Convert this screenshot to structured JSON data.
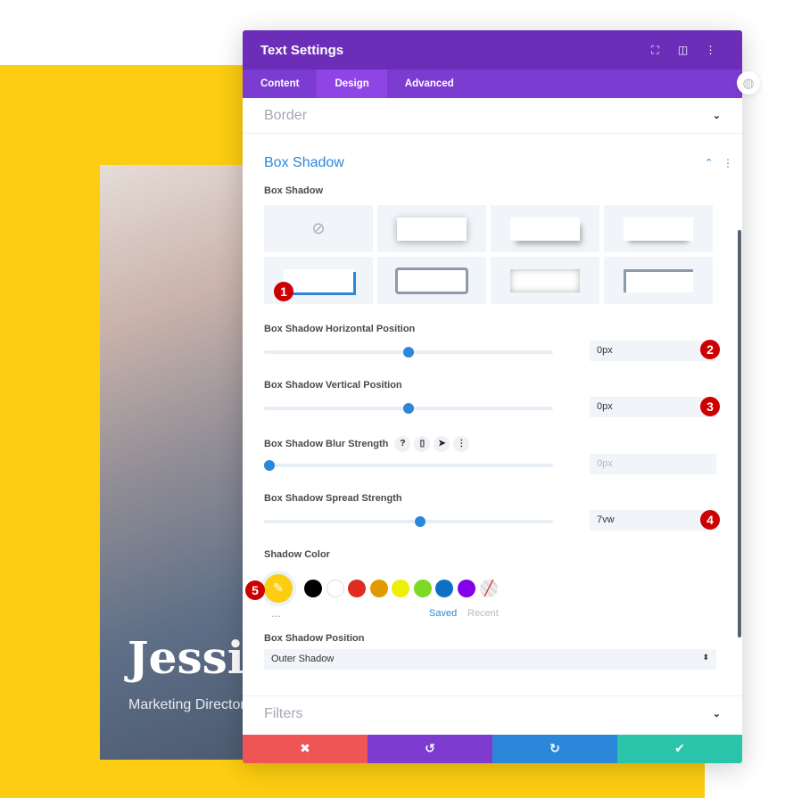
{
  "background": {
    "name": "Jessica",
    "role": "Marketing Director",
    "accent": "#fccd10"
  },
  "panel": {
    "title": "Text Settings",
    "header_icons": [
      "focus-icon",
      "sidebar-layout-icon",
      "more-vertical-icon"
    ],
    "tabs": [
      {
        "label": "Content"
      },
      {
        "label": "Design",
        "active": true
      },
      {
        "label": "Advanced"
      }
    ],
    "sections": {
      "border": "Border",
      "box_shadow": "Box Shadow",
      "filters": "Filters"
    },
    "box_shadow_label": "Box Shadow",
    "presets_selected": 4,
    "horizontal": {
      "label": "Box Shadow Horizontal Position",
      "value": "0px",
      "slider": 50
    },
    "vertical": {
      "label": "Box Shadow Vertical Position",
      "value": "0px",
      "slider": 50
    },
    "blur": {
      "label": "Box Shadow Blur Strength",
      "value": "0px",
      "slider": 0
    },
    "spread": {
      "label": "Box Shadow Spread Strength",
      "value": "7vw",
      "slider": 54
    },
    "shadow_color": {
      "label": "Shadow Color",
      "selected": "#fccd10",
      "swatches": [
        "#000000",
        "#ffffff",
        "#e02b20",
        "#e09900",
        "#edf000",
        "#7cda24",
        "#0c71c3",
        "#8300e9"
      ],
      "saved": "Saved",
      "recent": "Recent",
      "more": "..."
    },
    "position": {
      "label": "Box Shadow Position",
      "value": "Outer Shadow"
    },
    "footer": {
      "cancel": "✖",
      "undo": "↺",
      "redo": "↻",
      "save": "✔",
      "colors": [
        "#ef5555",
        "#7e3bd0",
        "#2b87da",
        "#29c4a9"
      ]
    }
  },
  "badges": [
    "1",
    "2",
    "3",
    "4",
    "5"
  ]
}
